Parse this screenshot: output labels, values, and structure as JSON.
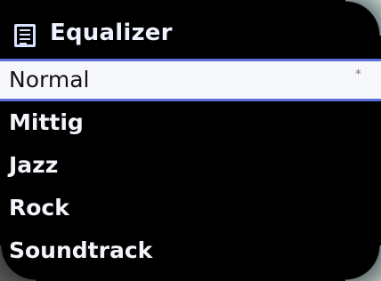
{
  "title": {
    "icon": "list-menu-icon",
    "text": "Equalizer"
  },
  "menu": {
    "items": [
      {
        "label": "Normal",
        "selected": true,
        "current_marker": "*"
      },
      {
        "label": "Mittig",
        "selected": false
      },
      {
        "label": "Jazz",
        "selected": false
      },
      {
        "label": "Rock",
        "selected": false
      },
      {
        "label": "Soundtrack",
        "selected": false
      }
    ]
  },
  "colors": {
    "screen_background": "#000000",
    "highlight_background": "#f7f8fb",
    "highlight_border": "#5b6fd8",
    "text": "#f2f4fa",
    "icon": "#d8e2ff"
  }
}
